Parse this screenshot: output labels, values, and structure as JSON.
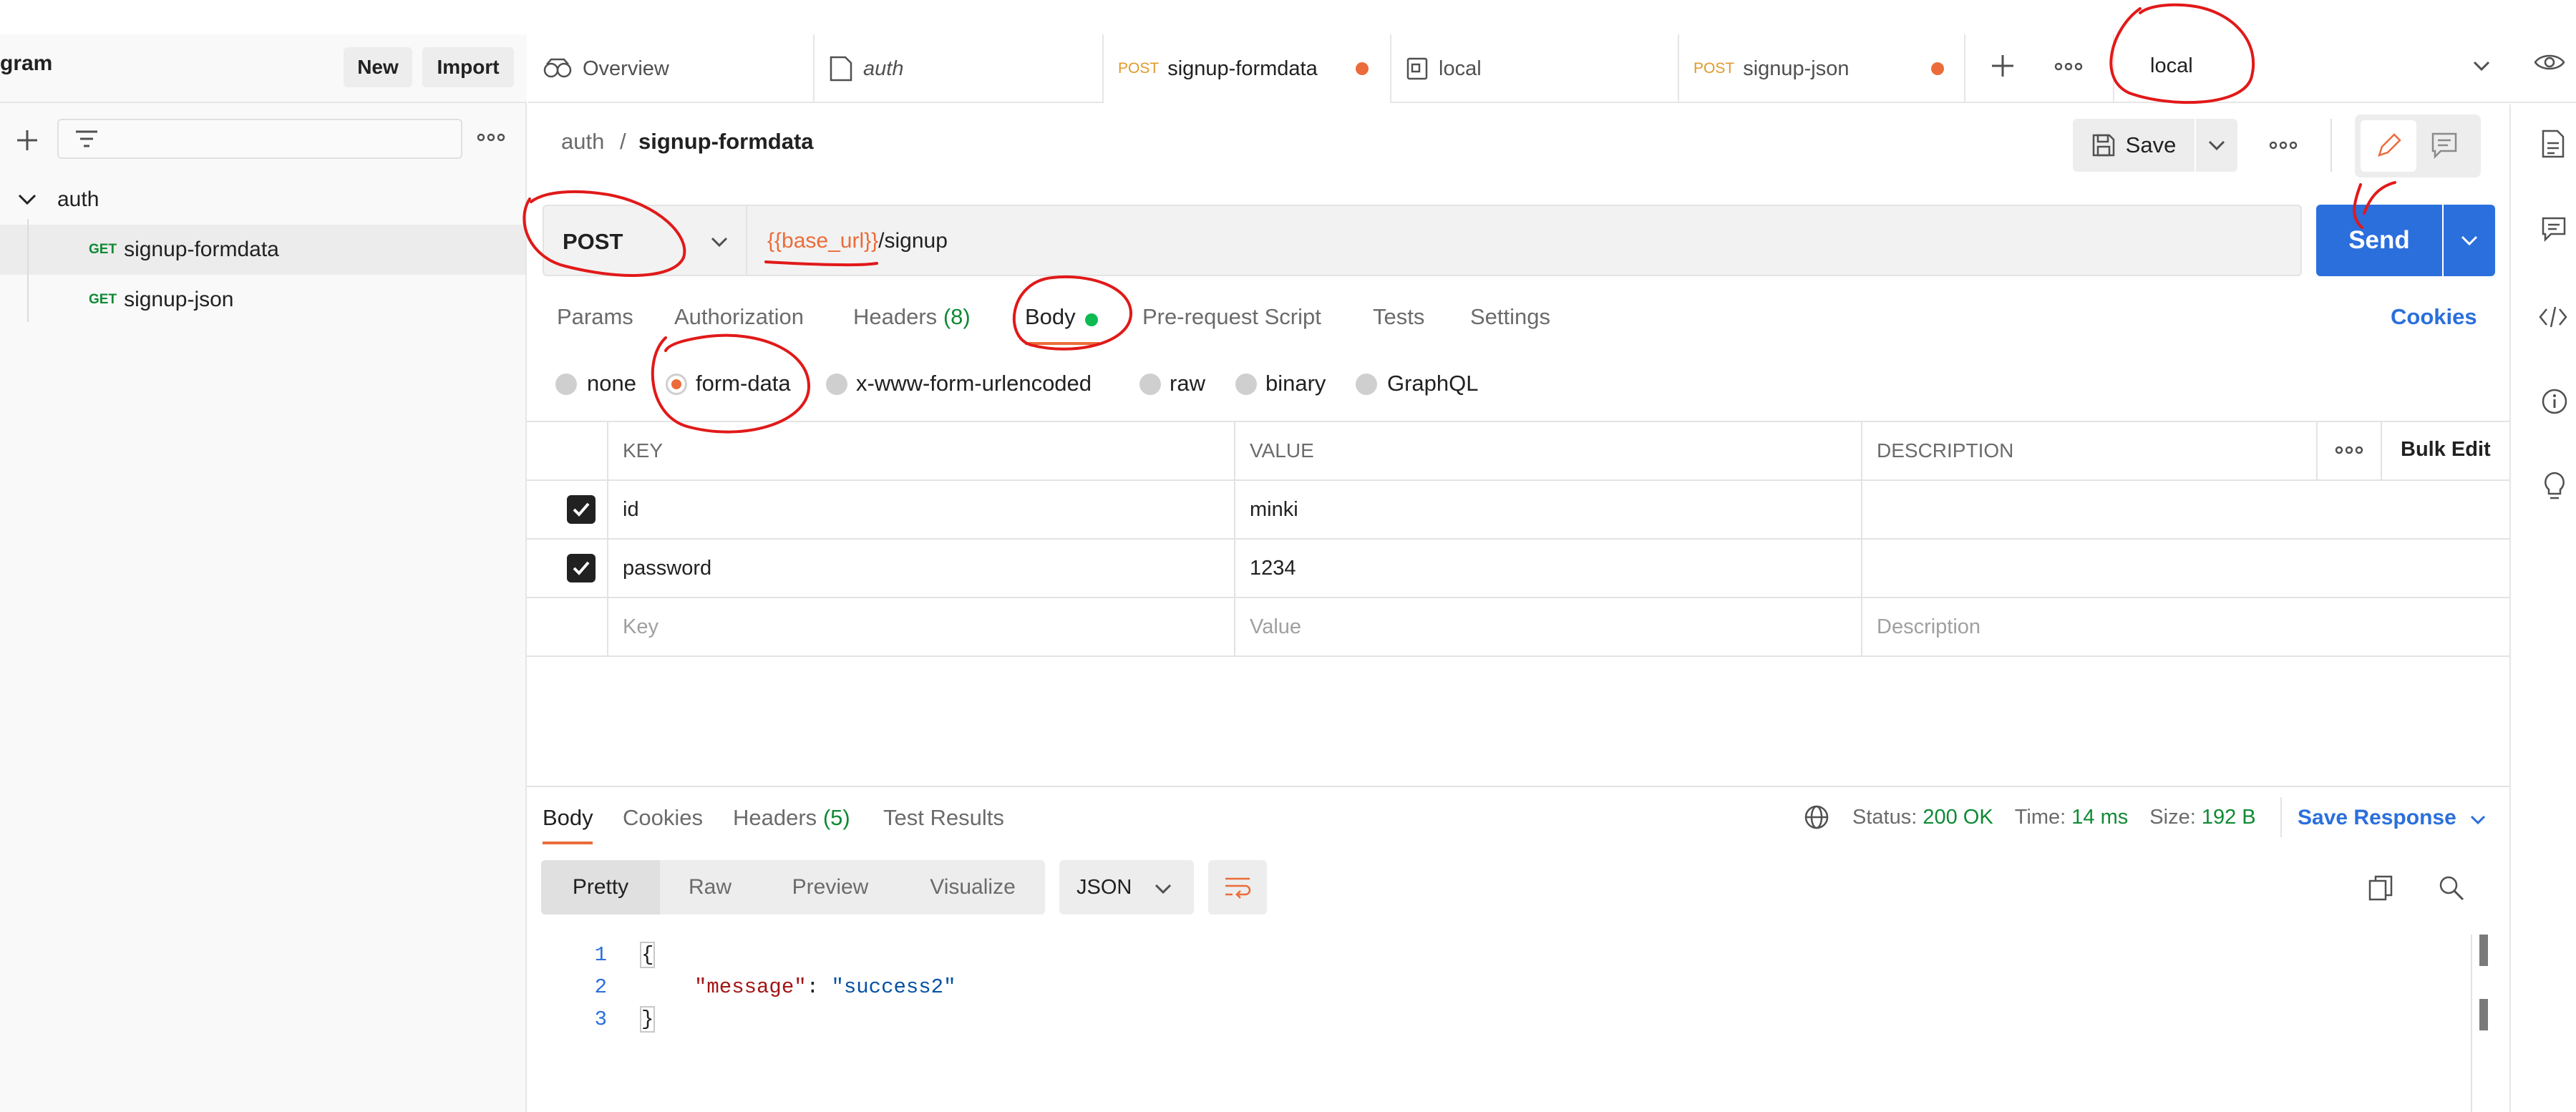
{
  "sidebar": {
    "workspace_title": "gram",
    "new_label": "New",
    "import_label": "Import",
    "collection": {
      "name": "auth",
      "requests": [
        {
          "method": "GET",
          "name": "signup-formdata"
        },
        {
          "method": "GET",
          "name": "signup-json"
        }
      ]
    }
  },
  "tabs": {
    "overview": "Overview",
    "auth": "auth",
    "tab3": {
      "method": "POST",
      "name": "signup-formdata"
    },
    "local": "local",
    "tab5": {
      "method": "POST",
      "name": "signup-json"
    },
    "environment": "local"
  },
  "request": {
    "breadcrumb_parent": "auth",
    "breadcrumb_sep": "/",
    "breadcrumb_current": "signup-formdata",
    "save_label": "Save",
    "method": "POST",
    "url_var": "{{base_url}}",
    "url_path": "/signup",
    "send_label": "Send",
    "subtabs": {
      "params": "Params",
      "authorization": "Authorization",
      "headers": "Headers",
      "headers_count": "(8)",
      "body": "Body",
      "prerequest": "Pre-request Script",
      "tests": "Tests",
      "settings": "Settings",
      "cookies": "Cookies"
    },
    "body_types": {
      "none": "none",
      "form_data": "form-data",
      "urlencoded": "x-www-form-urlencoded",
      "raw": "raw",
      "binary": "binary",
      "graphql": "GraphQL"
    },
    "table": {
      "headers": {
        "key": "KEY",
        "value": "VALUE",
        "description": "DESCRIPTION",
        "bulk_edit": "Bulk Edit"
      },
      "rows": [
        {
          "key": "id",
          "value": "minki",
          "checked": true
        },
        {
          "key": "password",
          "value": "1234",
          "checked": true
        }
      ],
      "placeholder": {
        "key": "Key",
        "value": "Value",
        "description": "Description"
      }
    }
  },
  "response": {
    "tabs": {
      "body": "Body",
      "cookies": "Cookies",
      "headers": "Headers",
      "headers_count": "(5)",
      "test_results": "Test Results"
    },
    "status_label": "Status:",
    "status_value": "200 OK",
    "time_label": "Time:",
    "time_value": "14 ms",
    "size_label": "Size:",
    "size_value": "192 B",
    "save_response": "Save Response",
    "view_modes": {
      "pretty": "Pretty",
      "raw": "Raw",
      "preview": "Preview",
      "visualize": "Visualize"
    },
    "format": "JSON",
    "code": {
      "line_numbers": [
        "1",
        "2",
        "3"
      ],
      "open_brace": "{",
      "key": "\"message\"",
      "colon": ":",
      "value": "\"success2\"",
      "close_brace": "}"
    }
  },
  "colors": {
    "accent_blue": "#2b6fdc",
    "orange": "#eb6c3a",
    "green_status": "#0f8a34",
    "annotation_red": "#e11919"
  }
}
